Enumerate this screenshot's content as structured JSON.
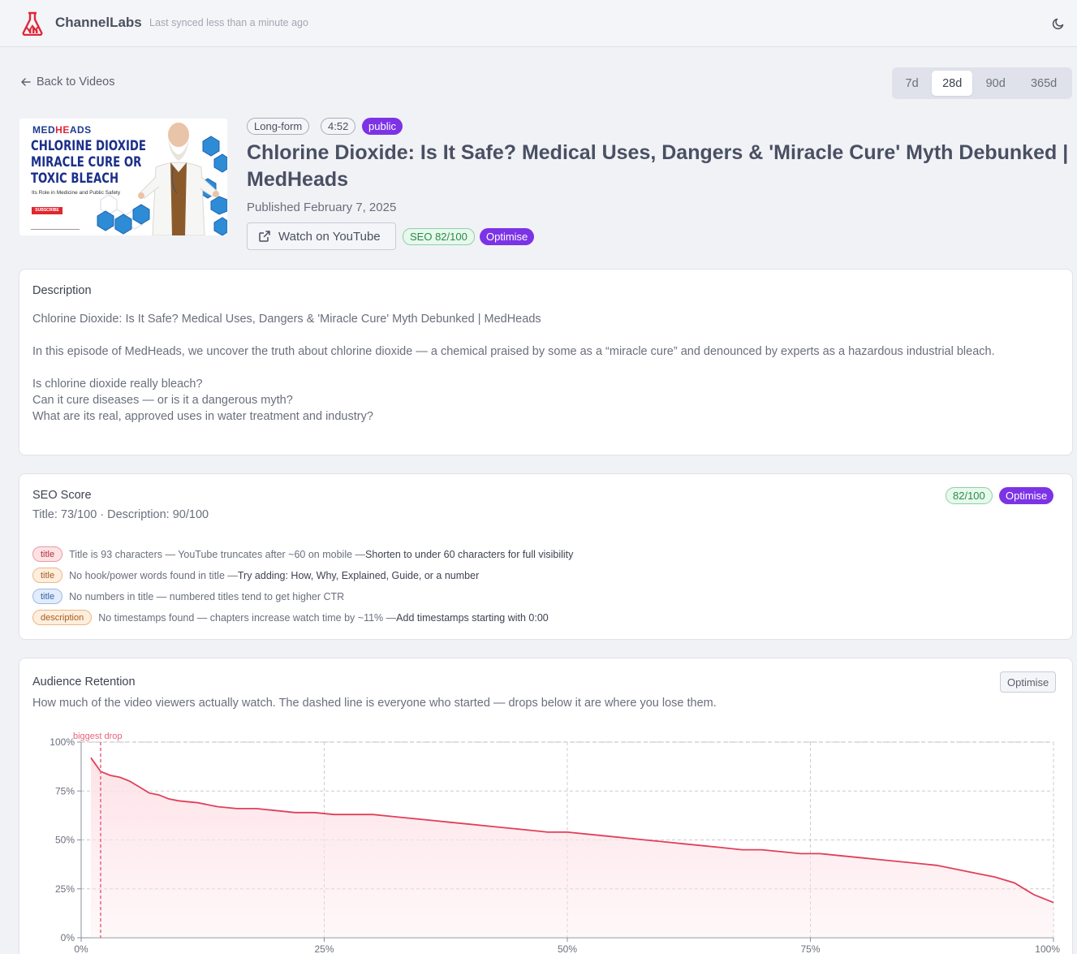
{
  "header": {
    "brand_bold": "Channel",
    "brand_light": "Labs",
    "sync_text": "Last synced less than a minute ago"
  },
  "nav": {
    "back_label": "Back to Videos",
    "ranges": [
      "7d",
      "28d",
      "90d",
      "365d"
    ],
    "active_range": "28d"
  },
  "thumbnail": {
    "brand_a": "MED",
    "brand_b": "HE",
    "brand_c": "ADS",
    "headline_1": "CHLORINE DIOXIDE",
    "headline_2": "MIRACLE CURE OR",
    "headline_3": "TOXIC BLEACH",
    "subline": "Its Role in Medicine and Public Safety",
    "subscribe": "SUBSCRIBE"
  },
  "video": {
    "format": "Long-form",
    "duration": "4:52",
    "visibility": "public",
    "title": "Chlorine Dioxide: Is It Safe? Medical Uses, Dangers & 'Miracle Cure' Myth Debunked | MedHeads",
    "published": "Published February 7, 2025",
    "watch_label": "Watch on YouTube",
    "seo_badge": "SEO 82/100",
    "optimise_label": "Optimise"
  },
  "description": {
    "heading": "Description",
    "body": "Chlorine Dioxide: Is It Safe? Medical Uses, Dangers & 'Miracle Cure' Myth Debunked | MedHeads\n\nIn this episode of MedHeads, we uncover the truth about chlorine dioxide — a chemical praised by some as a “miracle cure” and denounced by experts as a hazardous industrial bleach.\n\nIs chlorine dioxide really bleach?\nCan it cure diseases — or is it a dangerous myth?\nWhat are its real, approved uses in water treatment and industry?"
  },
  "seo": {
    "heading": "SEO Score",
    "score": "82/100",
    "optimise_label": "Optimise",
    "breakdown": "Title: 73/100 · Description: 90/100",
    "issues": [
      {
        "tag": "title",
        "severity": "red",
        "text": "Title is 93 characters — YouTube truncates after ~60 on mobile — ",
        "fix": "Shorten to under 60 characters for full visibility"
      },
      {
        "tag": "title",
        "severity": "orange",
        "text": "No hook/power words found in title — ",
        "fix": "Try adding: How, Why, Explained, Guide, or a number"
      },
      {
        "tag": "title",
        "severity": "blue",
        "text": "No numbers in title — numbered titles tend to get higher CTR",
        "fix": ""
      },
      {
        "tag": "description",
        "severity": "orange",
        "text": "No timestamps found — chapters increase watch time by ~11% — ",
        "fix": "Add timestamps starting with 0:00"
      }
    ]
  },
  "retention": {
    "heading": "Audience Retention",
    "optimise_label": "Optimise",
    "subtitle": "How much of the video viewers actually watch. The dashed line is everyone who started — drops below it are where you lose them.",
    "colors": {
      "line": "#e0405a",
      "fill": "#fde3e8",
      "marker": "#e8637a"
    }
  },
  "chart_data": {
    "type": "area",
    "title": "",
    "xlabel": "",
    "ylabel": "",
    "xlim": [
      0,
      100
    ],
    "ylim": [
      0,
      100
    ],
    "x_ticks": [
      "0%",
      "25%",
      "50%",
      "75%",
      "100%"
    ],
    "y_ticks": [
      "0%",
      "25%",
      "50%",
      "75%",
      "100%"
    ],
    "grid": true,
    "reference_line_y": 100,
    "annotation": {
      "label": "biggest drop",
      "x": 2
    },
    "x": [
      1,
      2,
      3,
      4,
      5,
      6,
      7,
      8,
      9,
      10,
      12,
      14,
      16,
      18,
      20,
      22,
      24,
      26,
      28,
      30,
      32,
      34,
      36,
      38,
      40,
      42,
      44,
      46,
      48,
      50,
      52,
      54,
      56,
      58,
      60,
      62,
      64,
      66,
      68,
      70,
      72,
      74,
      76,
      78,
      80,
      82,
      84,
      86,
      88,
      90,
      92,
      94,
      96,
      97,
      98,
      99,
      100
    ],
    "values": [
      92,
      85,
      83,
      82,
      80,
      77,
      74,
      73,
      71,
      70,
      69,
      67,
      66,
      66,
      65,
      64,
      64,
      63,
      63,
      63,
      62,
      61,
      60,
      59,
      58,
      57,
      56,
      55,
      54,
      54,
      53,
      52,
      51,
      50,
      49,
      48,
      47,
      46,
      45,
      45,
      44,
      43,
      43,
      42,
      41,
      40,
      39,
      38,
      37,
      35,
      33,
      31,
      28,
      25,
      22,
      20,
      18
    ]
  }
}
